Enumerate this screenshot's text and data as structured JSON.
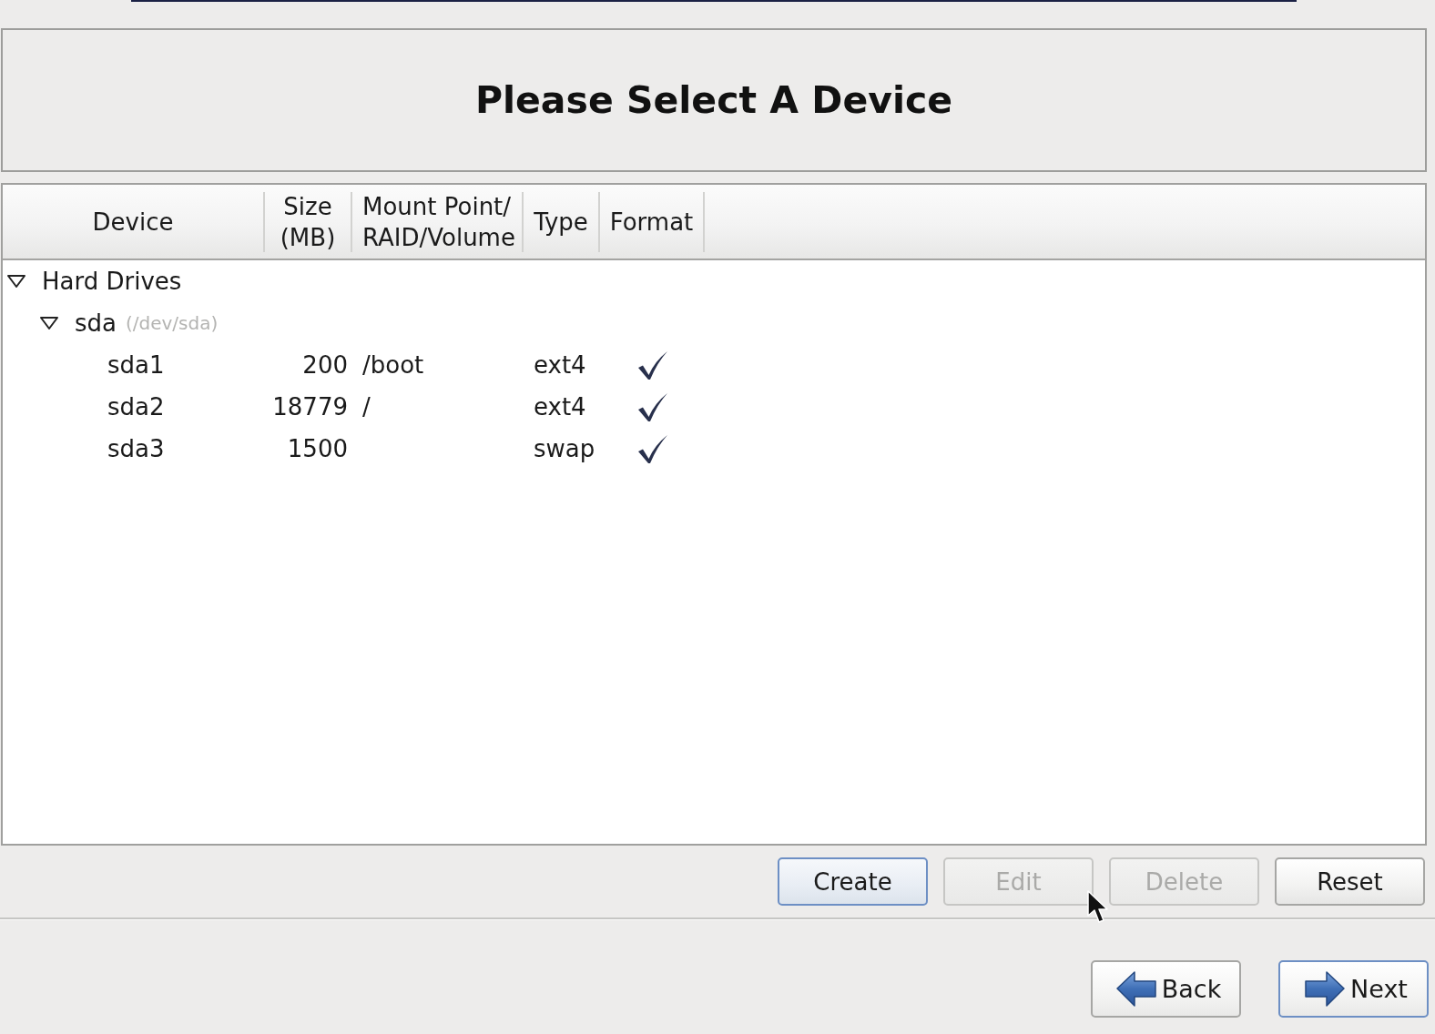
{
  "title": "Please Select A Device",
  "table": {
    "columns": [
      {
        "lines": [
          "Device"
        ]
      },
      {
        "lines": [
          "Size",
          "(MB)"
        ]
      },
      {
        "lines": [
          "Mount Point/",
          "RAID/Volume"
        ]
      },
      {
        "lines": [
          "Type"
        ]
      },
      {
        "lines": [
          "Format"
        ]
      }
    ],
    "tree": [
      {
        "kind": "group",
        "label": "Hard Drives",
        "expanded": true,
        "children": [
          {
            "kind": "group",
            "label": "sda",
            "path": "(/dev/sda)",
            "expanded": true,
            "children": [
              {
                "kind": "partition",
                "device": "sda1",
                "size": "200",
                "mount_point": "/boot",
                "type": "ext4",
                "format": true
              },
              {
                "kind": "partition",
                "device": "sda2",
                "size": "18779",
                "mount_point": "/",
                "type": "ext4",
                "format": true
              },
              {
                "kind": "partition",
                "device": "sda3",
                "size": "1500",
                "type": "swap",
                "format": true
              }
            ]
          }
        ]
      }
    ]
  },
  "actions": [
    {
      "label": "Create",
      "disabled": false,
      "focused": true
    },
    {
      "label": "Edit",
      "disabled": true,
      "focused": false
    },
    {
      "label": "Delete",
      "disabled": true,
      "focused": false
    },
    {
      "label": "Reset",
      "disabled": false,
      "focused": false
    }
  ],
  "navigation": [
    {
      "kind": "back",
      "label": "Back",
      "focused": false
    },
    {
      "kind": "next",
      "label": "Next",
      "focused": true
    }
  ]
}
